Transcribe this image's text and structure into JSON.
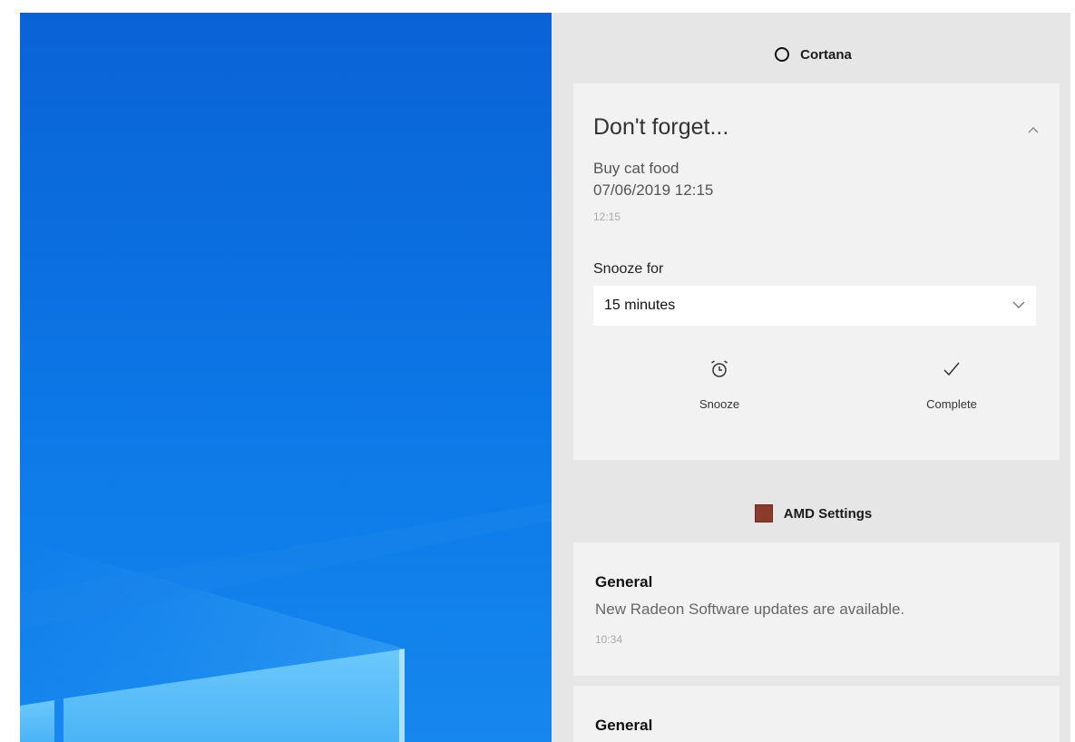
{
  "colors": {
    "wallpaper": "#0b6fe0",
    "action_center_bg": "#e6e6e6",
    "card_bg": "#f2f2f2",
    "amd_brand": "#8a3b2c"
  },
  "cortana": {
    "app_name": "Cortana",
    "icon": "cortana-ring-icon",
    "reminder": {
      "title": "Don't forget...",
      "task": "Buy cat food",
      "datetime": "07/06/2019 12:15",
      "time": "12:15",
      "snooze_label": "Snooze for",
      "snooze_selected": "15 minutes",
      "snooze_button": "Snooze",
      "complete_button": "Complete",
      "snooze_icon": "alarm-clock-icon",
      "complete_icon": "checkmark-icon"
    }
  },
  "amd": {
    "app_name": "AMD Settings",
    "icon": "amd-app-icon",
    "notifications": [
      {
        "title": "General",
        "body": "New Radeon Software updates are available.",
        "time": "10:34"
      },
      {
        "title": "General"
      }
    ]
  }
}
